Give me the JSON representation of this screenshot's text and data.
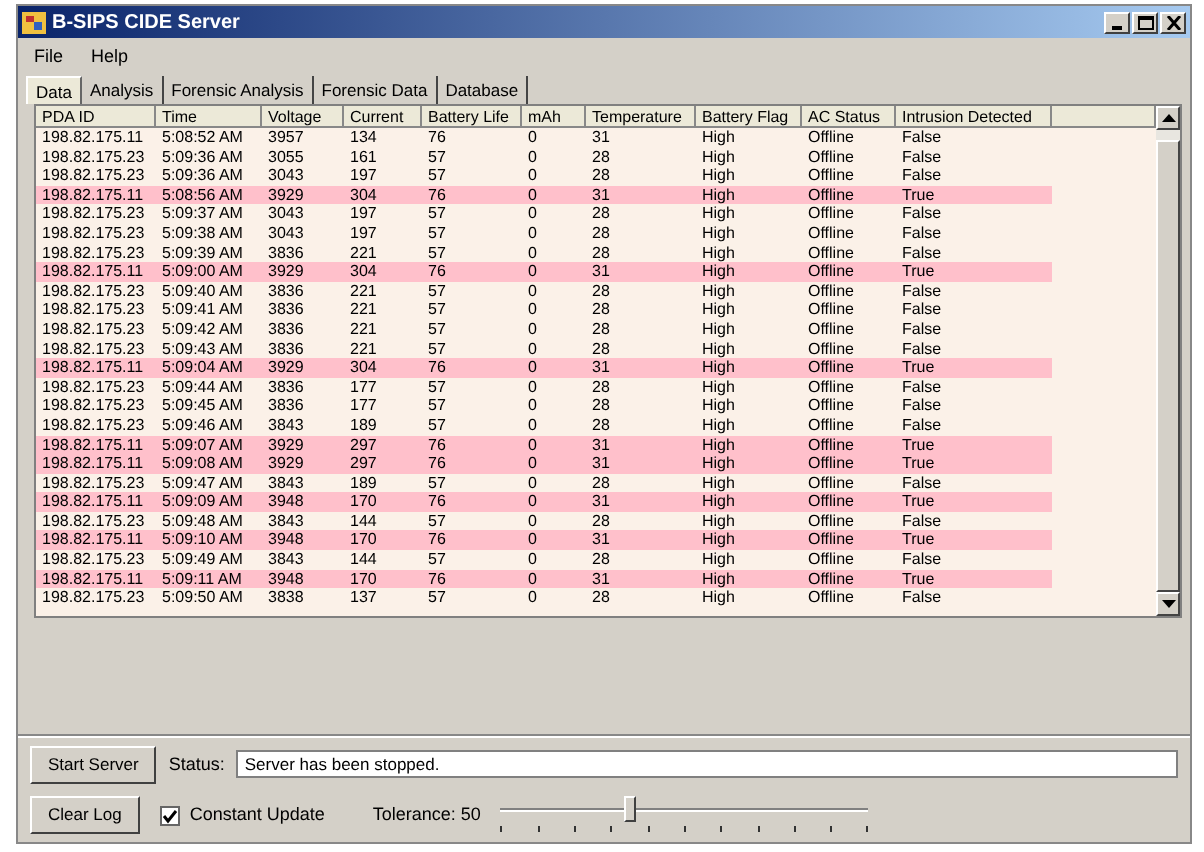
{
  "window": {
    "title": "B-SIPS CIDE Server"
  },
  "menu": [
    "File",
    "Help"
  ],
  "tabs": [
    {
      "label": "Data",
      "selected": true
    },
    {
      "label": "Analysis",
      "selected": false
    },
    {
      "label": "Forensic Analysis",
      "selected": false
    },
    {
      "label": "Forensic Data",
      "selected": false
    },
    {
      "label": "Database",
      "selected": false
    }
  ],
  "table": {
    "columns": [
      "PDA ID",
      "Time",
      "Voltage",
      "Current",
      "Battery Life",
      "mAh",
      "Temperature",
      "Battery Flag",
      "AC Status",
      "Intrusion Detected"
    ],
    "rows": [
      {
        "highlighted": false,
        "cells": [
          "198.82.175.11",
          "5:08:52 AM",
          "3957",
          "134",
          "76",
          "0",
          "31",
          "High",
          "Offline",
          "False"
        ]
      },
      {
        "highlighted": false,
        "cells": [
          "198.82.175.23",
          "5:09:36 AM",
          "3055",
          "161",
          "57",
          "0",
          "28",
          "High",
          "Offline",
          "False"
        ]
      },
      {
        "highlighted": false,
        "cells": [
          "198.82.175.23",
          "5:09:36 AM",
          "3043",
          "197",
          "57",
          "0",
          "28",
          "High",
          "Offline",
          "False"
        ]
      },
      {
        "highlighted": true,
        "cells": [
          "198.82.175.11",
          "5:08:56 AM",
          "3929",
          "304",
          "76",
          "0",
          "31",
          "High",
          "Offline",
          "True"
        ]
      },
      {
        "highlighted": false,
        "cells": [
          "198.82.175.23",
          "5:09:37 AM",
          "3043",
          "197",
          "57",
          "0",
          "28",
          "High",
          "Offline",
          "False"
        ]
      },
      {
        "highlighted": false,
        "cells": [
          "198.82.175.23",
          "5:09:38 AM",
          "3043",
          "197",
          "57",
          "0",
          "28",
          "High",
          "Offline",
          "False"
        ]
      },
      {
        "highlighted": false,
        "cells": [
          "198.82.175.23",
          "5:09:39 AM",
          "3836",
          "221",
          "57",
          "0",
          "28",
          "High",
          "Offline",
          "False"
        ]
      },
      {
        "highlighted": true,
        "cells": [
          "198.82.175.11",
          "5:09:00 AM",
          "3929",
          "304",
          "76",
          "0",
          "31",
          "High",
          "Offline",
          "True"
        ]
      },
      {
        "highlighted": false,
        "cells": [
          "198.82.175.23",
          "5:09:40 AM",
          "3836",
          "221",
          "57",
          "0",
          "28",
          "High",
          "Offline",
          "False"
        ]
      },
      {
        "highlighted": false,
        "cells": [
          "198.82.175.23",
          "5:09:41 AM",
          "3836",
          "221",
          "57",
          "0",
          "28",
          "High",
          "Offline",
          "False"
        ]
      },
      {
        "highlighted": false,
        "cells": [
          "198.82.175.23",
          "5:09:42 AM",
          "3836",
          "221",
          "57",
          "0",
          "28",
          "High",
          "Offline",
          "False"
        ]
      },
      {
        "highlighted": false,
        "cells": [
          "198.82.175.23",
          "5:09:43 AM",
          "3836",
          "221",
          "57",
          "0",
          "28",
          "High",
          "Offline",
          "False"
        ]
      },
      {
        "highlighted": true,
        "cells": [
          "198.82.175.11",
          "5:09:04 AM",
          "3929",
          "304",
          "76",
          "0",
          "31",
          "High",
          "Offline",
          "True"
        ]
      },
      {
        "highlighted": false,
        "cells": [
          "198.82.175.23",
          "5:09:44 AM",
          "3836",
          "177",
          "57",
          "0",
          "28",
          "High",
          "Offline",
          "False"
        ]
      },
      {
        "highlighted": false,
        "cells": [
          "198.82.175.23",
          "5:09:45 AM",
          "3836",
          "177",
          "57",
          "0",
          "28",
          "High",
          "Offline",
          "False"
        ]
      },
      {
        "highlighted": false,
        "cells": [
          "198.82.175.23",
          "5:09:46 AM",
          "3843",
          "189",
          "57",
          "0",
          "28",
          "High",
          "Offline",
          "False"
        ]
      },
      {
        "highlighted": true,
        "cells": [
          "198.82.175.11",
          "5:09:07 AM",
          "3929",
          "297",
          "76",
          "0",
          "31",
          "High",
          "Offline",
          "True"
        ]
      },
      {
        "highlighted": true,
        "cells": [
          "198.82.175.11",
          "5:09:08 AM",
          "3929",
          "297",
          "76",
          "0",
          "31",
          "High",
          "Offline",
          "True"
        ]
      },
      {
        "highlighted": false,
        "cells": [
          "198.82.175.23",
          "5:09:47 AM",
          "3843",
          "189",
          "57",
          "0",
          "28",
          "High",
          "Offline",
          "False"
        ]
      },
      {
        "highlighted": true,
        "cells": [
          "198.82.175.11",
          "5:09:09 AM",
          "3948",
          "170",
          "76",
          "0",
          "31",
          "High",
          "Offline",
          "True"
        ]
      },
      {
        "highlighted": false,
        "cells": [
          "198.82.175.23",
          "5:09:48 AM",
          "3843",
          "144",
          "57",
          "0",
          "28",
          "High",
          "Offline",
          "False"
        ]
      },
      {
        "highlighted": true,
        "cells": [
          "198.82.175.11",
          "5:09:10 AM",
          "3948",
          "170",
          "76",
          "0",
          "31",
          "High",
          "Offline",
          "True"
        ]
      },
      {
        "highlighted": false,
        "cells": [
          "198.82.175.23",
          "5:09:49 AM",
          "3843",
          "144",
          "57",
          "0",
          "28",
          "High",
          "Offline",
          "False"
        ]
      },
      {
        "highlighted": true,
        "cells": [
          "198.82.175.11",
          "5:09:11 AM",
          "3948",
          "170",
          "76",
          "0",
          "31",
          "High",
          "Offline",
          "True"
        ]
      },
      {
        "highlighted": false,
        "cells": [
          "198.82.175.23",
          "5:09:50 AM",
          "3838",
          "137",
          "57",
          "0",
          "28",
          "High",
          "Offline",
          "False"
        ]
      }
    ]
  },
  "start_button": "Start Server",
  "status": {
    "label": "Status:",
    "value": "Server has been stopped."
  },
  "clear_button": "Clear Log",
  "constant_update": {
    "label": "Constant Update",
    "checked": true
  },
  "tolerance": {
    "label": "Tolerance: 50",
    "level": 0.35
  }
}
